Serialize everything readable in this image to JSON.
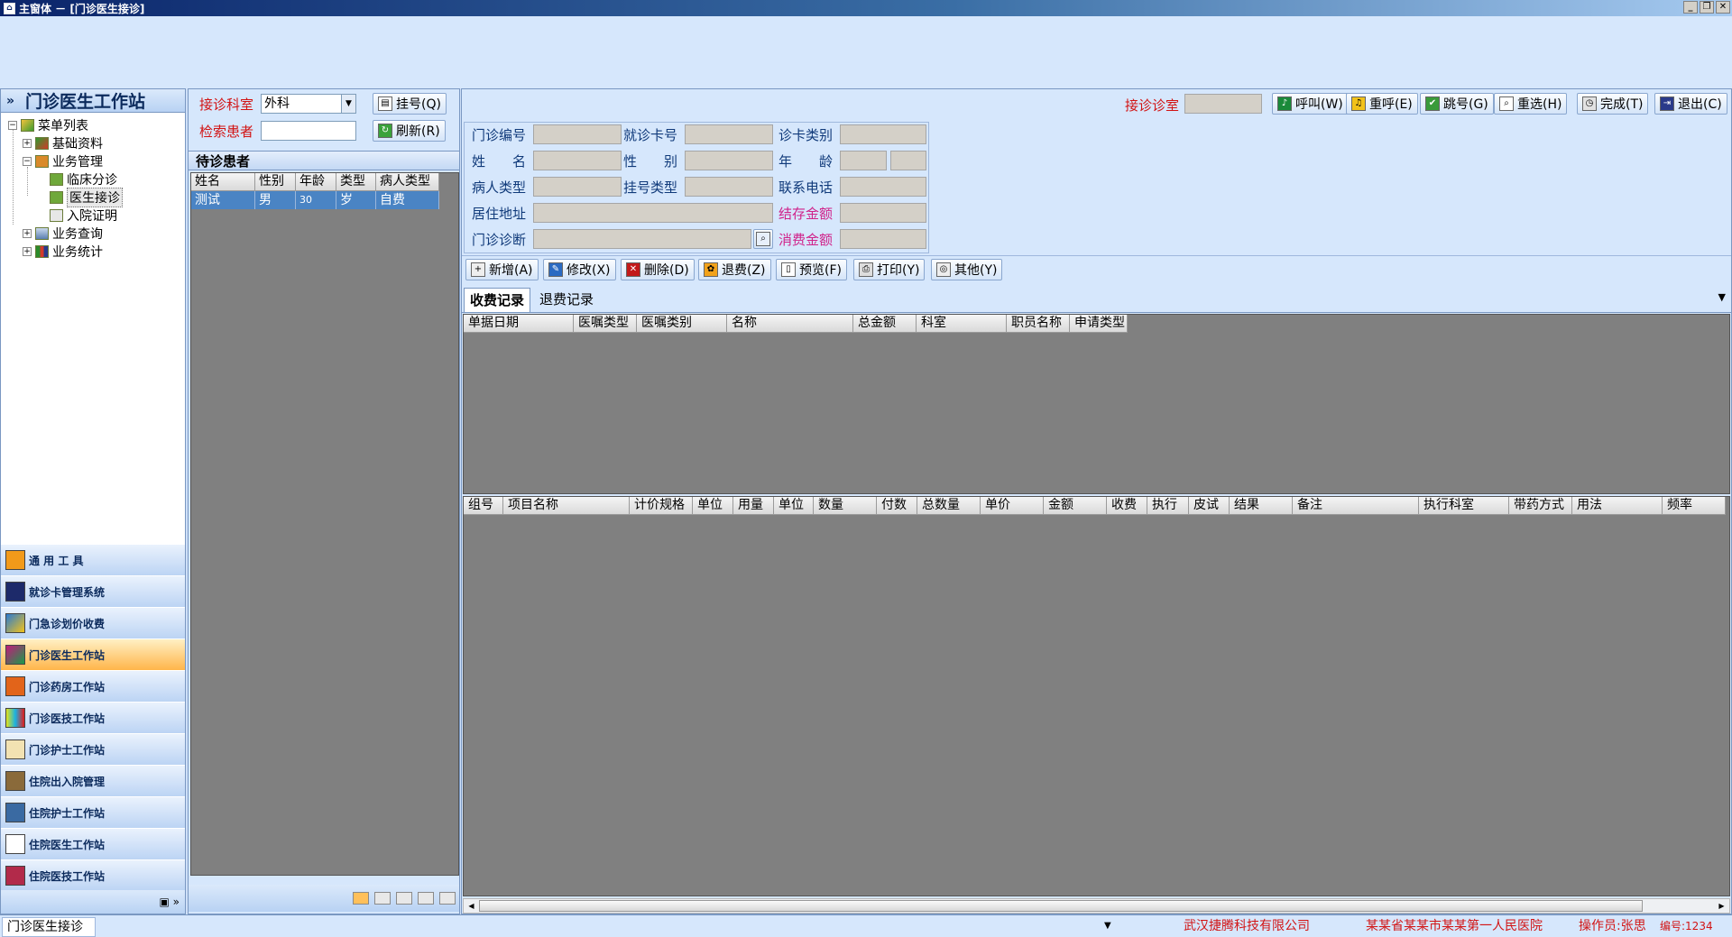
{
  "window": {
    "title": "主窗体 － [门诊医生接诊]"
  },
  "nav": {
    "title": "门诊医生工作站",
    "tree": [
      {
        "label": "菜单列表"
      },
      {
        "label": "基础资料"
      },
      {
        "label": "业务管理"
      },
      {
        "label": "临床分诊"
      },
      {
        "label": "医生接诊"
      },
      {
        "label": "入院证明"
      },
      {
        "label": "业务查询"
      },
      {
        "label": "业务统计"
      }
    ],
    "modules": [
      {
        "label": "通 用 工 具"
      },
      {
        "label": "就诊卡管理系统"
      },
      {
        "label": "门急诊划价收费"
      },
      {
        "label": "门诊医生工作站"
      },
      {
        "label": "门诊药房工作站"
      },
      {
        "label": "门诊医技工作站"
      },
      {
        "label": "门诊护士工作站"
      },
      {
        "label": "住院出入院管理"
      },
      {
        "label": "住院护士工作站"
      },
      {
        "label": "住院医生工作站"
      },
      {
        "label": "住院医技工作站"
      }
    ],
    "active_module": "门诊医生工作站"
  },
  "patient": {
    "dept_label": "接诊科室",
    "dept_value": "外科",
    "register_btn": "挂号(Q)",
    "search_label": "检索患者",
    "search_value": "",
    "refresh_btn": "刷新(R)",
    "waiting_title": "待诊患者",
    "columns": [
      "姓名",
      "性别",
      "年龄",
      "类型",
      "病人类型"
    ],
    "rows": [
      [
        "测试",
        "男",
        "30",
        "岁",
        "自费"
      ]
    ]
  },
  "main": {
    "room_label": "接诊诊室",
    "room_value": "",
    "toolbar": [
      "呼叫(W)",
      "重呼(E)",
      "跳号(G)",
      "重选(H)",
      "完成(T)",
      "退出(C)"
    ],
    "form": {
      "visit_no": "门诊编号",
      "card_no": "就诊卡号",
      "card_type": "诊卡类别",
      "name": "姓　　名",
      "gender": "性　　别",
      "age": "年　　龄",
      "patient_type": "病人类型",
      "reg_type": "挂号类型",
      "phone": "联系电话",
      "address": "居住地址",
      "balance": "结存金额",
      "diagnosis": "门诊诊断",
      "spent": "消费金额"
    },
    "actions": [
      "新增(A)",
      "修改(X)",
      "删除(D)",
      "退费(Z)",
      "预览(F)",
      "打印(Y)",
      "其他(Y)"
    ],
    "tabs": [
      "收费记录",
      "退费记录"
    ],
    "charge_columns": [
      "单据日期",
      "医嘱类型",
      "医嘱类别",
      "名称",
      "总金额",
      "科室",
      "职员名称",
      "申请类型"
    ],
    "detail_columns": [
      "组号",
      "项目名称",
      "计价规格",
      "单位",
      "用量",
      "单位",
      "数量",
      "付数",
      "总数量",
      "单价",
      "金额",
      "收费",
      "执行",
      "皮试",
      "结果",
      "备注",
      "执行科室",
      "带药方式",
      "用法",
      "频率"
    ]
  },
  "status": {
    "module": "门诊医生接诊",
    "company": "武汉捷腾科技有限公司",
    "hospital": "某某省某某市某某第一人民医院",
    "operator": "操作员:张思",
    "code": "编号:1234"
  },
  "colors": {
    "accent_red": "#d21414",
    "pink": "#d0228a",
    "highlight_row": "#4a84c4",
    "active_module": "#ffb54a"
  }
}
